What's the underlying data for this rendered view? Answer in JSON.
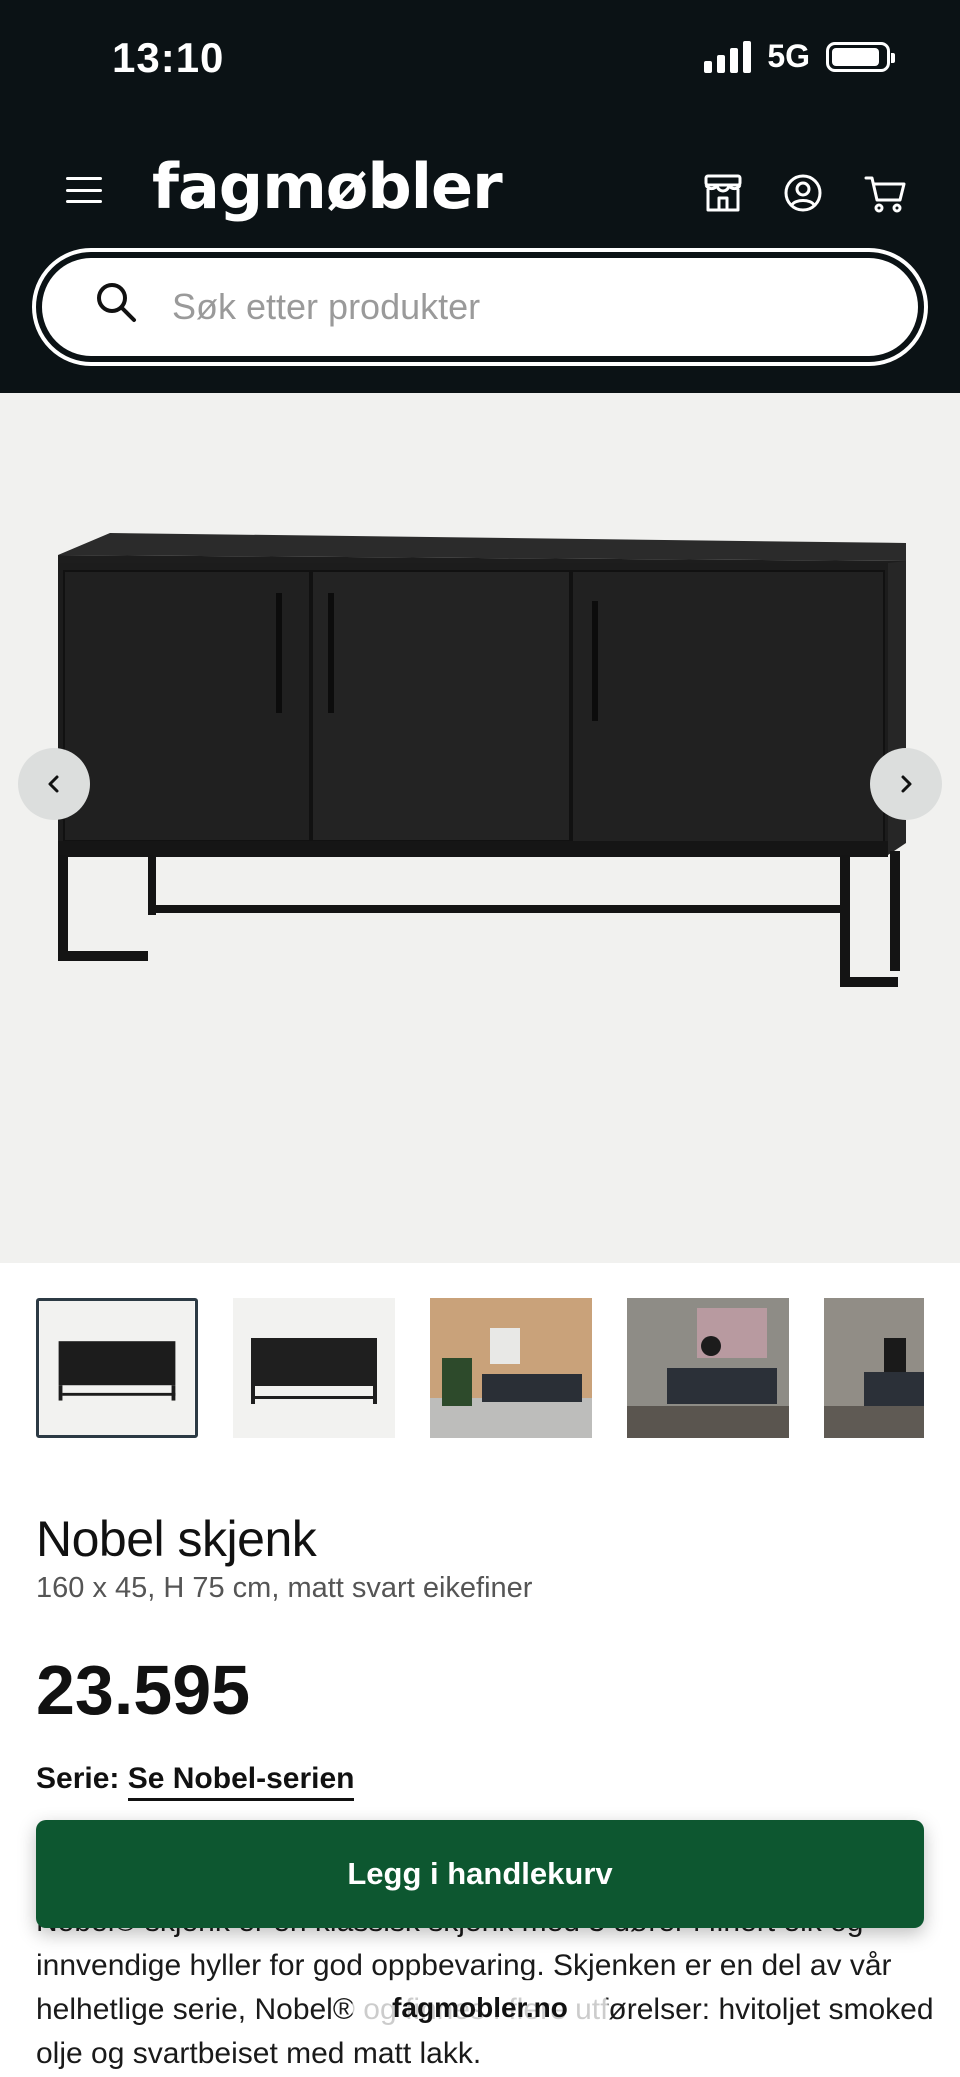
{
  "status_bar": {
    "time": "13:10",
    "network": "5G",
    "battery_level": 0.9
  },
  "header": {
    "logo": "fagmøbler",
    "icons": [
      "menu-icon",
      "store-icon",
      "account-icon",
      "cart-icon"
    ]
  },
  "search": {
    "placeholder": "Søk etter produkter",
    "value": ""
  },
  "gallery": {
    "prev_icon": "chevron-left-icon",
    "next_icon": "chevron-right-icon",
    "thumbnails": [
      "product-front",
      "product-angle",
      "room-plants",
      "room-lamp",
      "room-lamp-partial"
    ],
    "active_index": 0
  },
  "product": {
    "title": "Nobel skjenk",
    "subtitle": "160 x 45, H 75 cm, matt svart eikefiner",
    "price": "23.595",
    "series_label": "Serie:",
    "series_link": "Se Nobel-serien",
    "description": "Nobel® skjenk er en klassisk skjenk med 3 dører i finert eik og innvendige hyller for god oppbevaring. Skjenken er en del av vår helhetlige serie, Nobel® og finnes i flere utførelser: hvitoljet smoked olje og svartbeiset med matt lakk."
  },
  "cta": {
    "add_to_cart": "Legg i handlekurv"
  },
  "browser": {
    "domain": "fagmobler.no"
  },
  "colors": {
    "header_bg": "#0b1215",
    "cta_bg": "#0d5730",
    "hero_bg": "#f1f1ef"
  }
}
